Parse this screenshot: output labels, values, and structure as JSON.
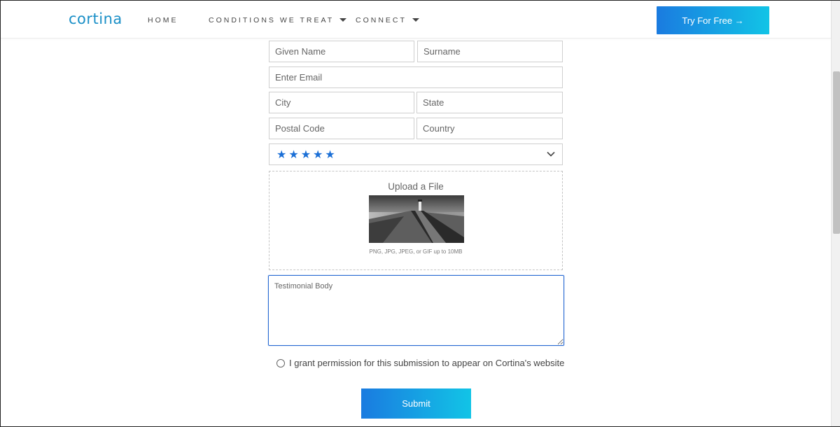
{
  "header": {
    "logo": "cortina",
    "nav": [
      {
        "label": "HOME"
      },
      {
        "label": "CONDITIONS WE TREAT"
      },
      {
        "label": "CONNECT"
      }
    ],
    "cta_label": "Try For Free →"
  },
  "form": {
    "given_name_placeholder": "Given Name",
    "surname_placeholder": "Surname",
    "email_placeholder": "Enter Email",
    "city_placeholder": "City",
    "state_placeholder": "State",
    "postal_code_placeholder": "Postal Code",
    "country_placeholder": "Country",
    "rating": {
      "selected_display": "★★★★★",
      "stars": 5,
      "max_stars": 5
    },
    "upload": {
      "title": "Upload a File",
      "hint": "PNG, JPG, JPEG, or GIF up to 10MB",
      "preview_icon": "lighthouse-pier-photo"
    },
    "testimonial_placeholder": "Testimonial Body",
    "consent_label": "I grant permission for this submission to appear on Cortina's website",
    "consent_checked": false,
    "submit_label": "Submit"
  },
  "colors": {
    "brand": "#1a8fc7",
    "accent_start": "#1a7be0",
    "accent_end": "#12c4e6",
    "star": "#1b6fd6",
    "focus": "#2a6bd3"
  }
}
